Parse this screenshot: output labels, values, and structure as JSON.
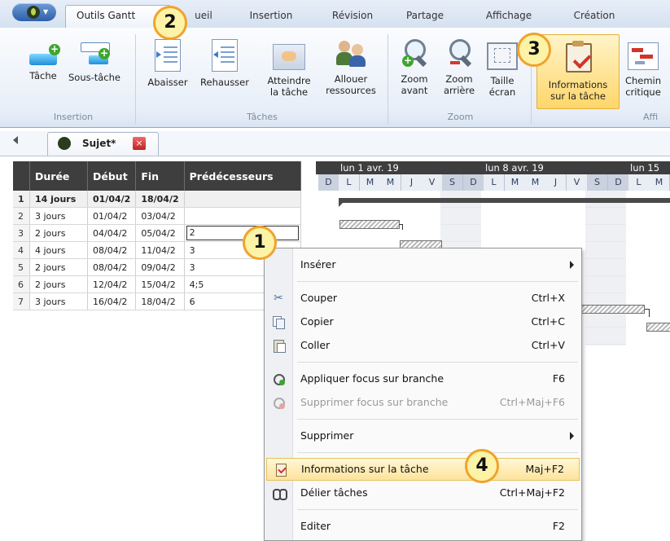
{
  "tabs": {
    "active": "Outils Gantt",
    "items": [
      "ueil",
      "Insertion",
      "Révision",
      "Partage",
      "Affichage",
      "Création"
    ]
  },
  "ribbon": {
    "insertion": {
      "task": "Tâche",
      "subtask": "Sous-tâche",
      "group": "Insertion"
    },
    "taches": {
      "demote": "Abaisser",
      "promote": "Rehausser",
      "reach_1": "Atteindre",
      "reach_2": "la tâche",
      "assign_1": "Allouer",
      "assign_2": "ressources",
      "group": "Tâches"
    },
    "zoom": {
      "zin_1": "Zoom",
      "zin_2": "avant",
      "zout_1": "Zoom",
      "zout_2": "arrière",
      "fit_1": "Taille",
      "fit_2": "écran",
      "group": "Zoom"
    },
    "info": {
      "line1": "Informations",
      "line2": "sur la tâche"
    },
    "critical": {
      "line1": "Chemin",
      "line2": "critique",
      "group_partial": "Affi"
    }
  },
  "doc_tab": {
    "title": "Sujet*"
  },
  "grid": {
    "headers": [
      "Durée",
      "Début",
      "Fin",
      "Prédécesseurs"
    ],
    "rows": [
      {
        "n": "1",
        "duree": "14 jours",
        "debut": "01/04/2",
        "fin": "18/04/2",
        "pred": ""
      },
      {
        "n": "2",
        "duree": "3 jours",
        "debut": "01/04/2",
        "fin": "03/04/2",
        "pred": ""
      },
      {
        "n": "3",
        "duree": "2 jours",
        "debut": "04/04/2",
        "fin": "05/04/2",
        "pred": "2"
      },
      {
        "n": "4",
        "duree": "4 jours",
        "debut": "08/04/2",
        "fin": "11/04/2",
        "pred": "3"
      },
      {
        "n": "5",
        "duree": "2 jours",
        "debut": "08/04/2",
        "fin": "09/04/2",
        "pred": "3"
      },
      {
        "n": "6",
        "duree": "2 jours",
        "debut": "12/04/2",
        "fin": "15/04/2",
        "pred": "4;5"
      },
      {
        "n": "7",
        "duree": "3 jours",
        "debut": "16/04/2",
        "fin": "18/04/2",
        "pred": "6"
      }
    ]
  },
  "gantt": {
    "weeks": [
      "lun 1 avr. 19",
      "lun 8 avr. 19",
      "lun 15"
    ],
    "days": [
      "D",
      "L",
      "M",
      "M",
      "J",
      "V",
      "S",
      "D",
      "L",
      "M",
      "M",
      "J",
      "V",
      "S",
      "D",
      "L",
      "M"
    ]
  },
  "menu": {
    "insert": "Insérer",
    "cut": "Couper",
    "cut_sc": "Ctrl+X",
    "copy": "Copier",
    "copy_sc": "Ctrl+C",
    "paste": "Coller",
    "paste_sc": "Ctrl+V",
    "focus": "Appliquer focus sur branche",
    "focus_sc": "F6",
    "unfocus": "Supprimer focus sur branche",
    "unfocus_sc": "Ctrl+Maj+F6",
    "delete": "Supprimer",
    "info": "Informations sur la tâche",
    "info_sc": "Maj+F2",
    "unlink": "Délier tâches",
    "unlink_sc": "Ctrl+Maj+F2",
    "edit": "Editer",
    "edit_sc": "F2"
  },
  "callouts": [
    "1",
    "2",
    "3",
    "4"
  ]
}
